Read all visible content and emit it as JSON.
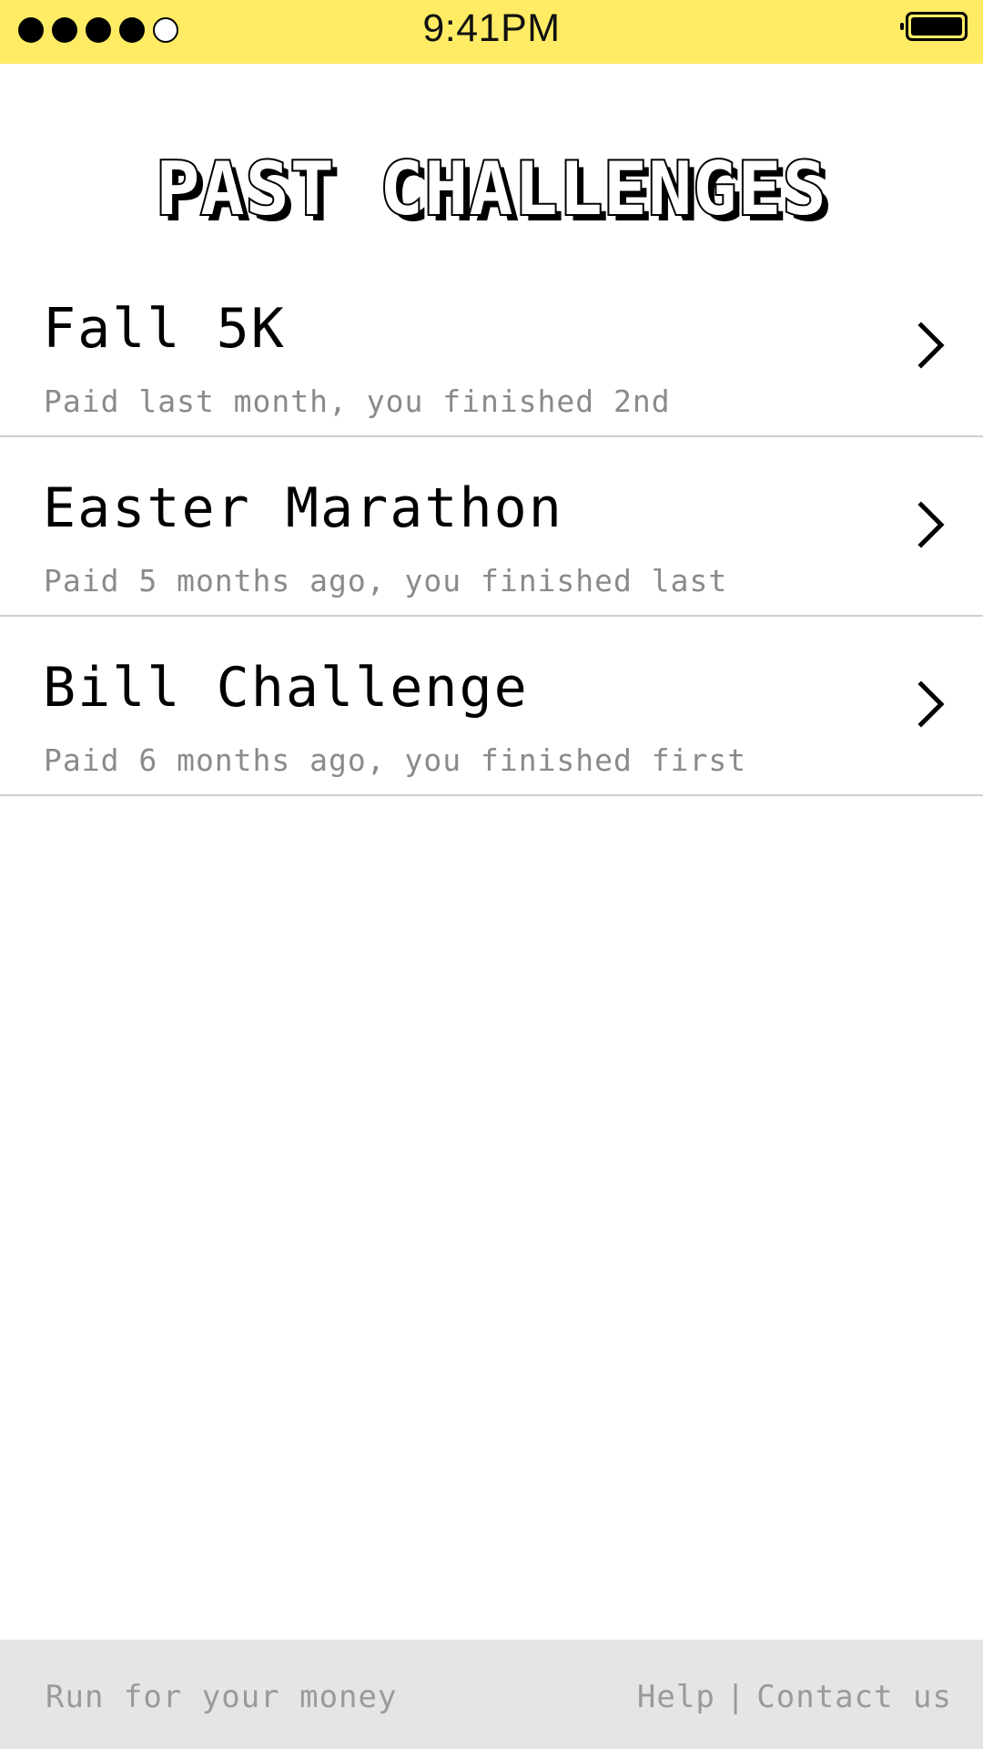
{
  "status_bar": {
    "time": "9:41PM",
    "signal_filled": 4,
    "signal_total": 5,
    "battery_level": 1.0
  },
  "page": {
    "title": "PAST CHALLENGES"
  },
  "challenges": [
    {
      "title": "Fall 5K",
      "subtitle": "Paid last month, you finished 2nd"
    },
    {
      "title": "Easter Marathon",
      "subtitle": "Paid 5 months ago, you finished last"
    },
    {
      "title": "Bill Challenge",
      "subtitle": "Paid 6 months ago, you finished first"
    }
  ],
  "footer": {
    "tagline": "Run for your money",
    "help_label": "Help",
    "separator": "|",
    "contact_label": "Contact us"
  },
  "colors": {
    "status_bar_bg": "#ffec64",
    "footer_bg": "#e5e5e5",
    "subtitle_text": "#8a8a8a"
  }
}
